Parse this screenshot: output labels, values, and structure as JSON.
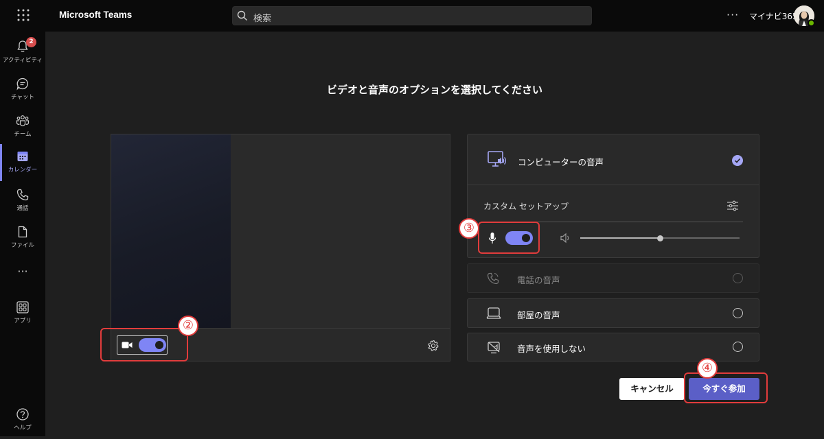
{
  "app": {
    "title": "Microsoft Teams"
  },
  "search": {
    "placeholder": "検索"
  },
  "user": {
    "name": "マイナビ365"
  },
  "rail": {
    "activity": {
      "label": "アクティビティ",
      "badge": "2"
    },
    "chat": {
      "label": "チャット"
    },
    "teams": {
      "label": "チーム"
    },
    "calendar": {
      "label": "カレンダー"
    },
    "calls": {
      "label": "通話"
    },
    "files": {
      "label": "ファイル"
    },
    "more": {
      "label": "···"
    },
    "apps": {
      "label": "アプリ"
    },
    "help": {
      "label": "ヘルプ"
    }
  },
  "main": {
    "title": "ビデオと音声のオプションを選択してください"
  },
  "audio": {
    "computer": "コンピューターの音声",
    "custom_setup": "カスタム セットアップ",
    "phone": "電話の音声",
    "room": "部屋の音声",
    "none": "音声を使用しない",
    "speaker_volume": 0.5
  },
  "annotations": {
    "two": "②",
    "three": "③",
    "four": "④"
  },
  "buttons": {
    "cancel": "キャンセル",
    "join": "今すぐ参加"
  },
  "colors": {
    "accent": "#7f85f5",
    "join": "#5b5fc7",
    "highlight": "#e23c3c"
  },
  "icons": {
    "app_launcher": "waffle-icon",
    "search": "search-icon",
    "more": "more-icon",
    "camera": "camera-icon",
    "settings": "gear-icon",
    "mic": "mic-icon",
    "speaker": "speaker-icon",
    "tune": "settings-sliders-icon",
    "computer_audio": "computer-audio-icon",
    "phone": "phone-icon",
    "room": "room-display-icon",
    "no_audio": "no-audio-icon"
  }
}
